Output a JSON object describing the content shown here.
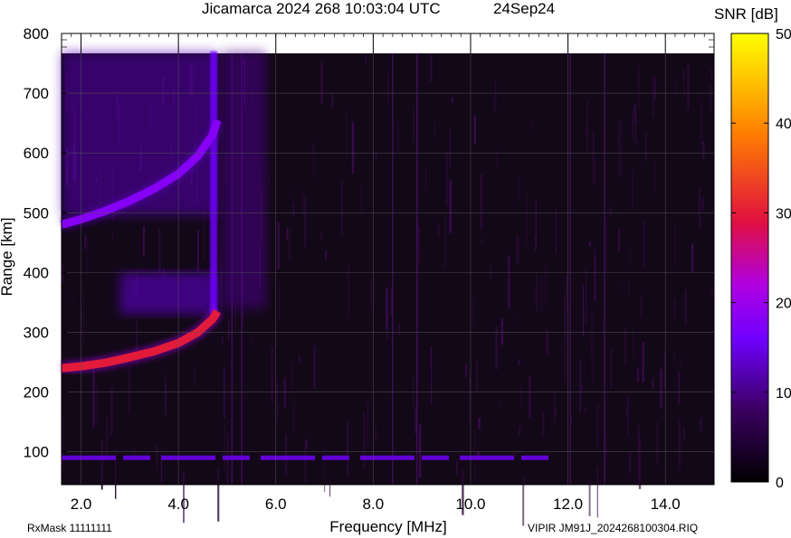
{
  "header": {
    "title": "Jicamarca 2024 268 10:03:04 UTC",
    "date": "24Sep24"
  },
  "footer": {
    "rxmask": "RxMask 11111111",
    "filename": "VIPIR  JM91J_2024268100304.RIQ"
  },
  "colorbar": {
    "label": "SNR [dB]",
    "ticks": [
      0,
      10,
      20,
      30,
      40,
      50
    ]
  },
  "chart_data": {
    "type": "heatmap",
    "title": "Jicamarca 2024 268 10:03:04 UTC",
    "xlabel": "Frequency [MHz]",
    "ylabel": "Range [km]",
    "xlim": [
      1.6,
      15.0
    ],
    "ylim": [
      45,
      800
    ],
    "x_ticks": [
      "2.0",
      "4.0",
      "6.0",
      "8.0",
      "10.0",
      "12.0",
      "14.0"
    ],
    "y_ticks": [
      100,
      200,
      300,
      400,
      500,
      600,
      700,
      800
    ],
    "color_scale": {
      "label": "SNR [dB]",
      "min": 0,
      "max": 50,
      "colors": [
        "#000000",
        "#3a0060",
        "#7000ff",
        "#b000e0",
        "#e01040",
        "#ff8000",
        "#ffff00"
      ]
    },
    "grid": true,
    "series": [
      {
        "name": "F-layer O trace",
        "points": [
          [
            1.6,
            240
          ],
          [
            2.0,
            243
          ],
          [
            2.5,
            249
          ],
          [
            3.0,
            258
          ],
          [
            3.5,
            268
          ],
          [
            4.0,
            282
          ],
          [
            4.4,
            300
          ],
          [
            4.7,
            322
          ],
          [
            4.8,
            335
          ]
        ],
        "snr_db": 30
      },
      {
        "name": "F-layer multiple echo",
        "points": [
          [
            1.6,
            480
          ],
          [
            2.0,
            489
          ],
          [
            2.5,
            503
          ],
          [
            3.0,
            520
          ],
          [
            3.5,
            540
          ],
          [
            4.0,
            565
          ],
          [
            4.4,
            595
          ],
          [
            4.7,
            630
          ],
          [
            4.8,
            655
          ]
        ],
        "snr_db": 18
      },
      {
        "name": "E-region echo",
        "points": [
          [
            1.6,
            90
          ],
          [
            11.6,
            90
          ]
        ],
        "snr_db": 14
      }
    ],
    "regions": [
      {
        "name": "spread echo 1",
        "x": [
          2.8,
          4.8
        ],
        "y": [
          330,
          400
        ],
        "snr_db": 14
      },
      {
        "name": "spread echo 2",
        "x": [
          1.6,
          4.8
        ],
        "y": [
          495,
          770
        ],
        "snr_db": 12
      },
      {
        "name": "spread echo 3",
        "x": [
          4.9,
          5.8
        ],
        "y": [
          340,
          770
        ],
        "snr_db": 10
      }
    ]
  }
}
